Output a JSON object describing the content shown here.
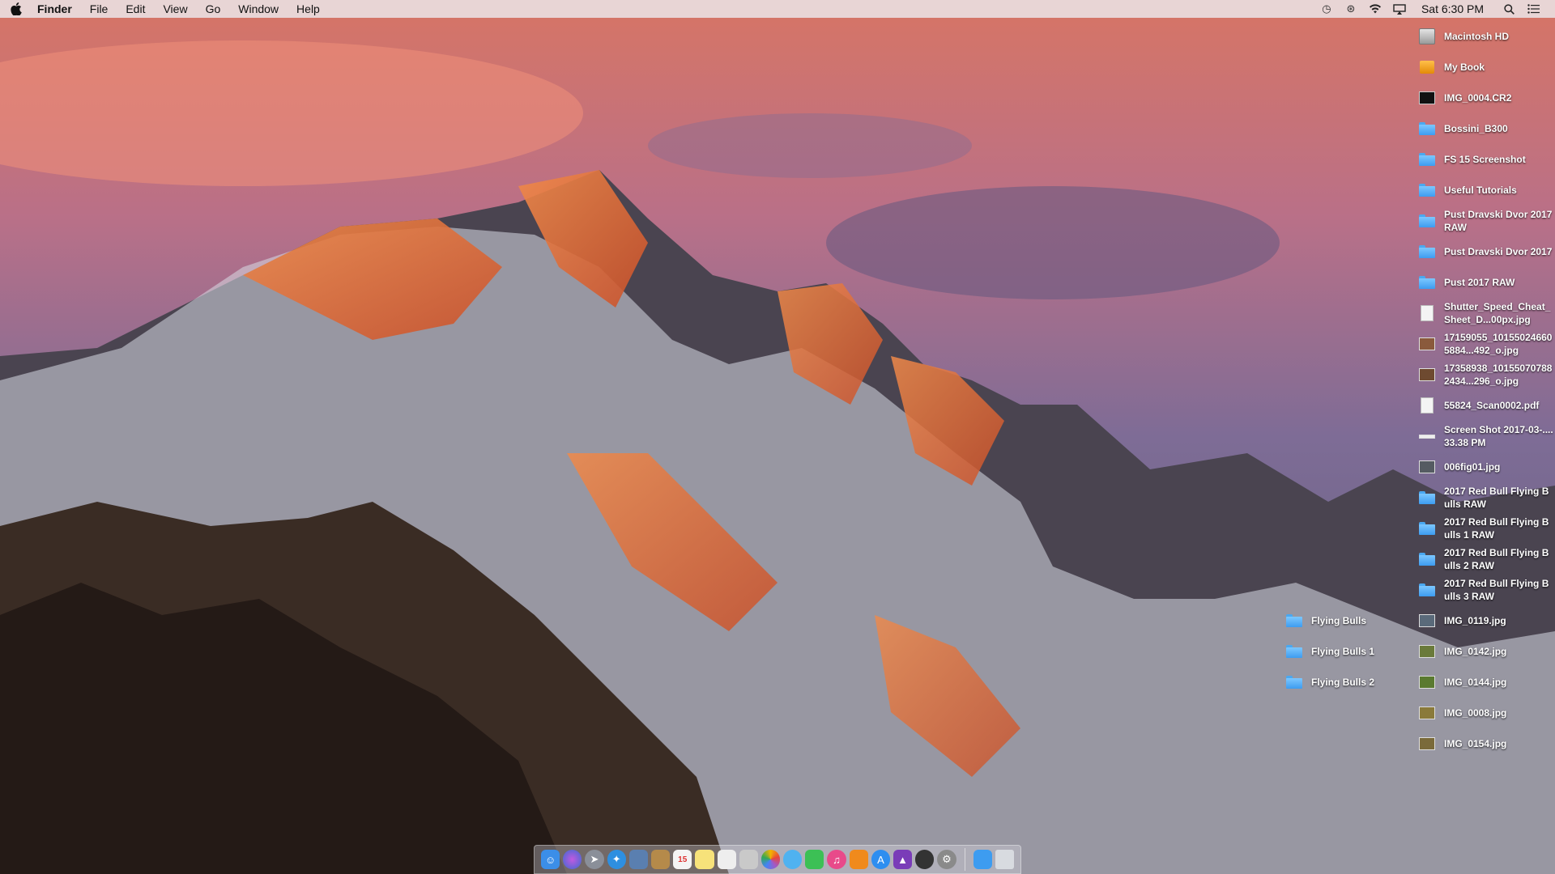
{
  "menubar": {
    "apple_icon": "apple-icon",
    "app_name": "Finder",
    "menus": [
      "File",
      "Edit",
      "View",
      "Go",
      "Window",
      "Help"
    ],
    "status_icons": [
      "time-machine-icon",
      "bluetooth-icon",
      "wifi-icon",
      "airplay-icon"
    ],
    "clock": "Sat 6:30 PM",
    "right_icons": [
      "spotlight-search-icon",
      "notification-center-icon"
    ]
  },
  "desktop_icons_right": [
    {
      "label": "Macintosh HD",
      "kind": "drive-hd"
    },
    {
      "label": "My Book",
      "kind": "drive-external"
    },
    {
      "label": "IMG_0004.CR2",
      "kind": "raw-image"
    },
    {
      "label": "Bossini_B300",
      "kind": "folder"
    },
    {
      "label": "FS 15 Screenshot",
      "kind": "folder"
    },
    {
      "label": "Useful Tutorials",
      "kind": "folder"
    },
    {
      "label": "Pust Dravski Dvor 2017 RAW",
      "kind": "folder"
    },
    {
      "label": "Pust Dravski Dvor 2017",
      "kind": "folder"
    },
    {
      "label": "Pust 2017 RAW",
      "kind": "folder"
    },
    {
      "label": "Shutter_Speed_Cheat_Sheet_D...00px.jpg",
      "kind": "image"
    },
    {
      "label": "17159055_101550246605884...492_o.jpg",
      "kind": "image"
    },
    {
      "label": "17358938_101550707882434...296_o.jpg",
      "kind": "image"
    },
    {
      "label": "55824_Scan0002.pdf",
      "kind": "document"
    },
    {
      "label": "Screen Shot 2017-03-....33.38 PM",
      "kind": "image"
    },
    {
      "label": "006fig01.jpg",
      "kind": "image"
    },
    {
      "label": "2017 Red Bull Flying Bulls RAW",
      "kind": "folder"
    },
    {
      "label": "2017 Red Bull Flying Bulls 1 RAW",
      "kind": "folder"
    },
    {
      "label": "2017 Red Bull Flying Bulls 2 RAW",
      "kind": "folder"
    },
    {
      "label": "2017 Red Bull Flying Bulls 3 RAW",
      "kind": "folder"
    },
    {
      "label": "IMG_0119.jpg",
      "kind": "image"
    },
    {
      "label": "IMG_0142.jpg",
      "kind": "image"
    },
    {
      "label": "IMG_0144.jpg",
      "kind": "image"
    },
    {
      "label": "IMG_0008.jpg",
      "kind": "image"
    },
    {
      "label": "IMG_0154.jpg",
      "kind": "image"
    }
  ],
  "desktop_icons_left": [
    {
      "label": "Flying Bulls",
      "kind": "folder"
    },
    {
      "label": "Flying Bulls 1",
      "kind": "folder"
    },
    {
      "label": "Flying Bulls 2",
      "kind": "folder"
    }
  ],
  "dock": {
    "apps": [
      {
        "name": "finder-icon",
        "color": "#3b8ee8"
      },
      {
        "name": "siri-icon",
        "color": "#6b5bd6"
      },
      {
        "name": "launchpad-icon",
        "color": "#8a8f99"
      },
      {
        "name": "safari-icon",
        "color": "#2e8fe0"
      },
      {
        "name": "preview-icon",
        "color": "#5a7fb0"
      },
      {
        "name": "notes-folder-icon",
        "color": "#b58a4a"
      },
      {
        "name": "calendar-icon",
        "color": "#f4f4f4"
      },
      {
        "name": "stickies-icon",
        "color": "#f7e27a"
      },
      {
        "name": "reminders-icon",
        "color": "#eeeeee"
      },
      {
        "name": "photos-preview-icon",
        "color": "#c9c9c9"
      },
      {
        "name": "photos-icon",
        "color": "#e8a03c"
      },
      {
        "name": "messages-icon",
        "color": "#4fb2f0"
      },
      {
        "name": "facetime-icon",
        "color": "#3cc055"
      },
      {
        "name": "itunes-icon",
        "color": "#e84a8a"
      },
      {
        "name": "ibooks-icon",
        "color": "#f08a1c"
      },
      {
        "name": "app-store-icon",
        "color": "#2d8ef0"
      },
      {
        "name": "affinity-photo-icon",
        "color": "#7a3cb8"
      },
      {
        "name": "camera-app-icon",
        "color": "#333333"
      },
      {
        "name": "system-preferences-icon",
        "color": "#8a8a8a"
      }
    ],
    "right": [
      {
        "name": "downloads-folder-icon",
        "color": "#3d9cf0"
      },
      {
        "name": "trash-icon",
        "color": "#d8dbe0"
      }
    ]
  }
}
